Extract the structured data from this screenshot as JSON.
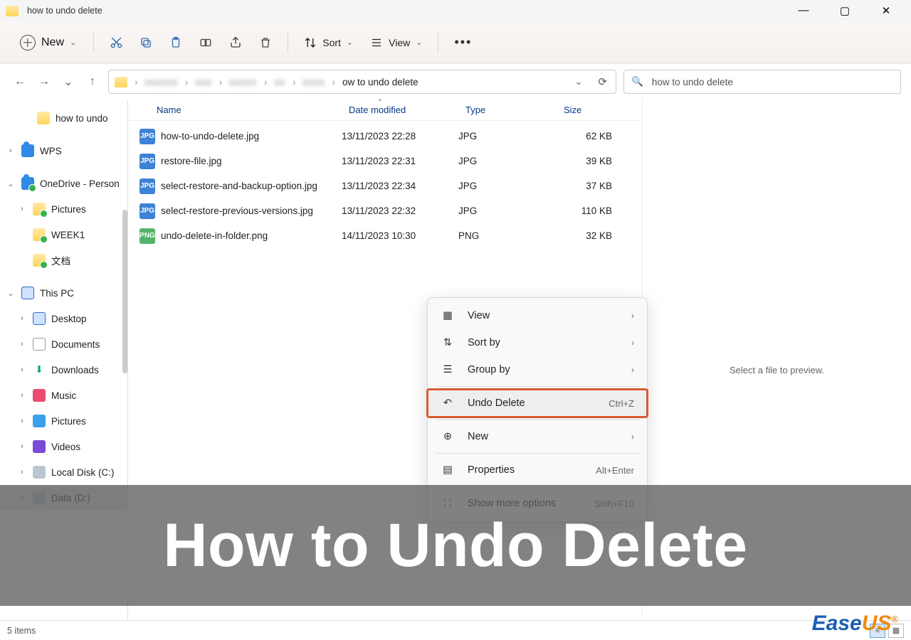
{
  "title": "how to undo delete",
  "toolbar": {
    "new": "New",
    "sort": "Sort",
    "view": "View"
  },
  "address": {
    "current": "ow to undo delete"
  },
  "search": {
    "value": "how to undo delete"
  },
  "sidebar": {
    "top": "how to undo",
    "wps": "WPS",
    "onedrive": "OneDrive - Person",
    "pictures": "Pictures",
    "week1": "WEEK1",
    "docs_cn": "文档",
    "thispc": "This PC",
    "desktop": "Desktop",
    "documents": "Documents",
    "downloads": "Downloads",
    "music": "Music",
    "pictures2": "Pictures",
    "videos": "Videos",
    "diskc": "Local Disk (C:)",
    "diskd": "Data (D:)"
  },
  "columns": {
    "name": "Name",
    "modified": "Date modified",
    "type": "Type",
    "size": "Size"
  },
  "files": [
    {
      "name": "how-to-undo-delete.jpg",
      "modified": "13/11/2023 22:28",
      "type": "JPG",
      "size": "62 KB",
      "ext": "jpg"
    },
    {
      "name": "restore-file.jpg",
      "modified": "13/11/2023 22:31",
      "type": "JPG",
      "size": "39 KB",
      "ext": "jpg"
    },
    {
      "name": "select-restore-and-backup-option.jpg",
      "modified": "13/11/2023 22:34",
      "type": "JPG",
      "size": "37 KB",
      "ext": "jpg"
    },
    {
      "name": "select-restore-previous-versions.jpg",
      "modified": "13/11/2023 22:32",
      "type": "JPG",
      "size": "110 KB",
      "ext": "jpg"
    },
    {
      "name": "undo-delete-in-folder.png",
      "modified": "14/11/2023 10:30",
      "type": "PNG",
      "size": "32 KB",
      "ext": "png"
    }
  ],
  "preview_text": "Select a file to preview.",
  "context_menu": {
    "view": "View",
    "sortby": "Sort by",
    "groupby": "Group by",
    "undo": "Undo Delete",
    "undo_hint": "Ctrl+Z",
    "new": "New",
    "properties": "Properties",
    "properties_hint": "Alt+Enter",
    "more": "Show more options",
    "more_hint": "Shift+F10"
  },
  "status": "5 items",
  "banner": "How to Undo Delete",
  "logo": {
    "ease": "Ease",
    "us": "US"
  }
}
